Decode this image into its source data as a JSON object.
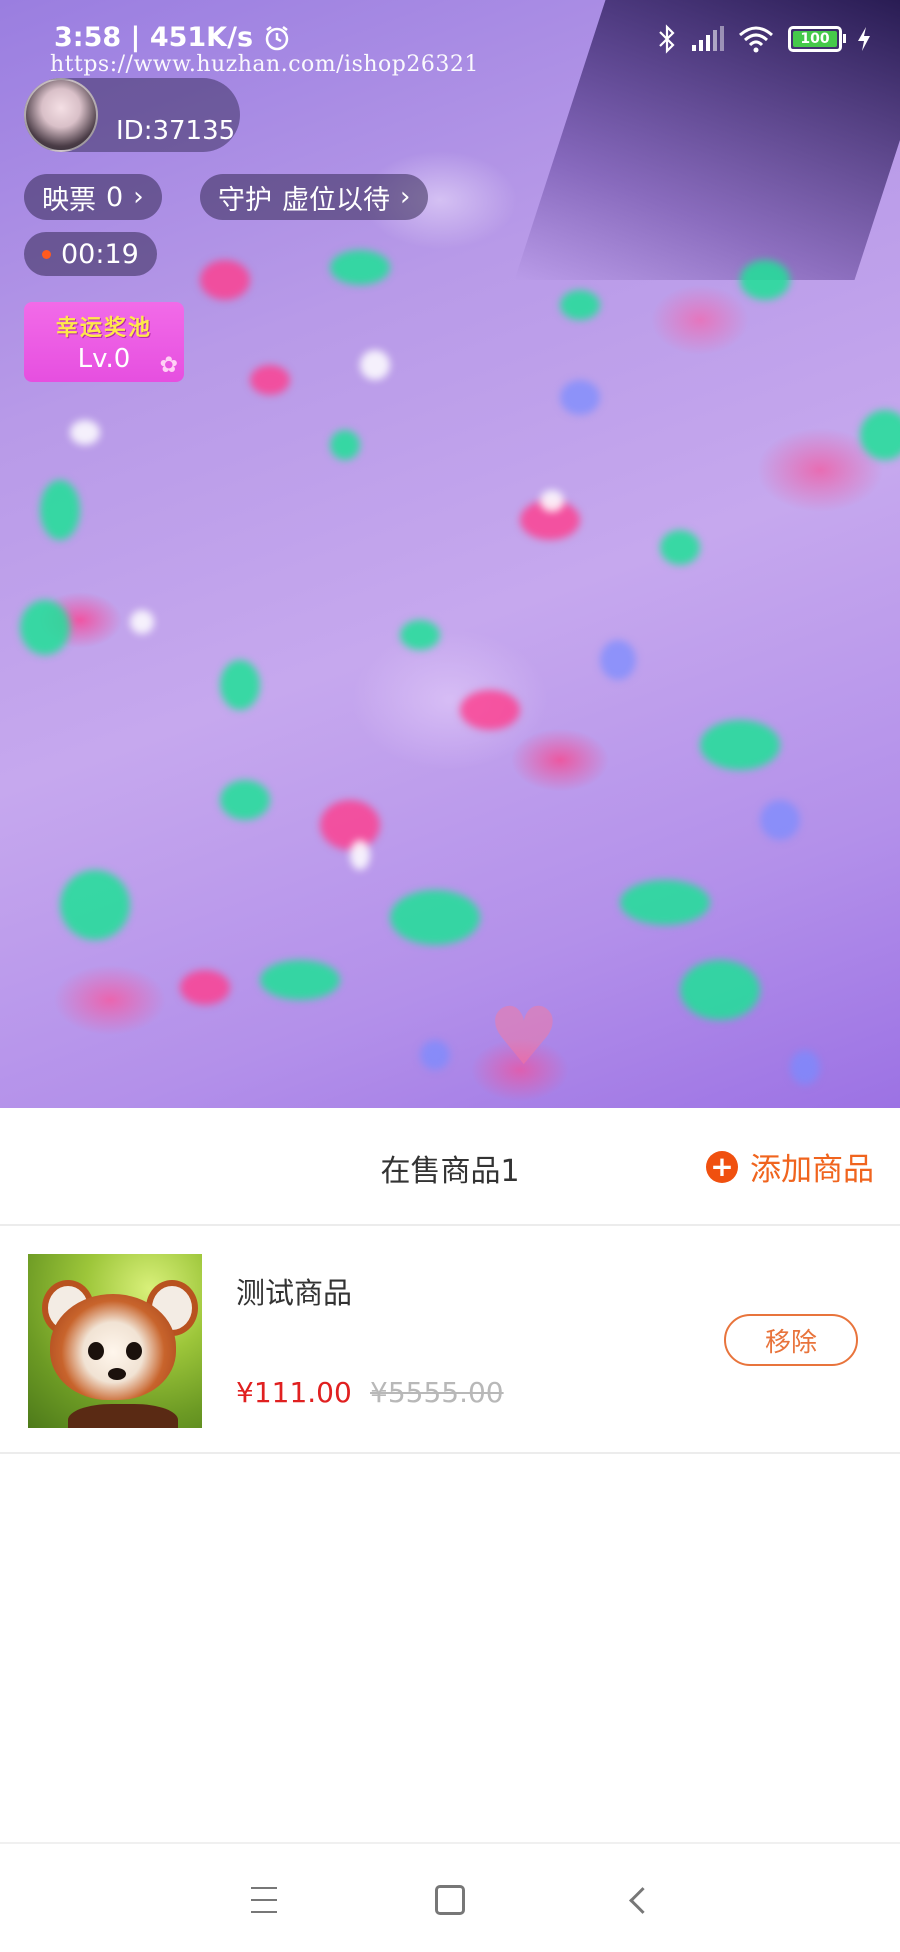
{
  "status_bar": {
    "time_speed": "3:58 | 451K/s",
    "battery_level": "100"
  },
  "watermark": "https://www.huzhan.com/ishop26321",
  "anchor": {
    "id_label": "ID:37135"
  },
  "stats": {
    "ticket_label": "映票",
    "ticket_count": "0",
    "guard_label": "守护",
    "guard_value": "虚位以待"
  },
  "live_timer": "00:19",
  "lucky_pool": {
    "title": "幸运奖池",
    "level": "Lv.0"
  },
  "goods_panel": {
    "title": "在售商品1",
    "add_label": "添加商品",
    "items": [
      {
        "name": "测试商品",
        "price": "¥111.00",
        "original_price": "¥5555.00",
        "remove_label": "移除"
      }
    ]
  },
  "colors": {
    "accent_orange": "#f0641e",
    "price_red": "#e02020"
  }
}
